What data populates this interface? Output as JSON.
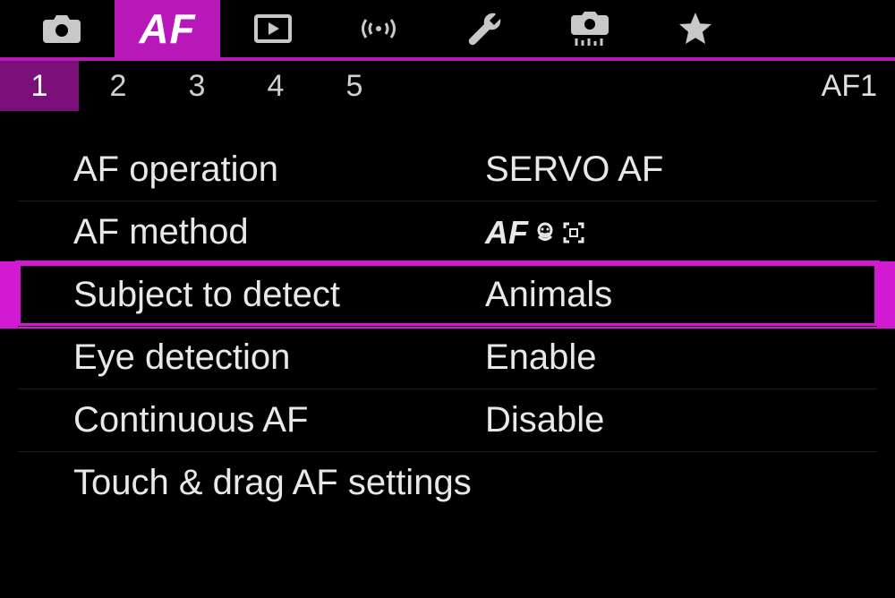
{
  "topTabs": {
    "active_index": 1,
    "af_label": "AF"
  },
  "subTabs": {
    "items": [
      "1",
      "2",
      "3",
      "4",
      "5"
    ],
    "active_index": 0,
    "page_label": "AF1"
  },
  "settings": {
    "selected_index": 2,
    "rows": [
      {
        "label": "AF operation",
        "value": "SERVO AF"
      },
      {
        "label": "AF method",
        "value": "AF",
        "icon_value": true
      },
      {
        "label": "Subject to detect",
        "value": "Animals"
      },
      {
        "label": "Eye detection",
        "value": "Enable"
      },
      {
        "label": "Continuous AF",
        "value": "Disable"
      },
      {
        "label": "Touch & drag AF settings",
        "value": ""
      }
    ]
  },
  "colors": {
    "accent": "#b718b7"
  }
}
